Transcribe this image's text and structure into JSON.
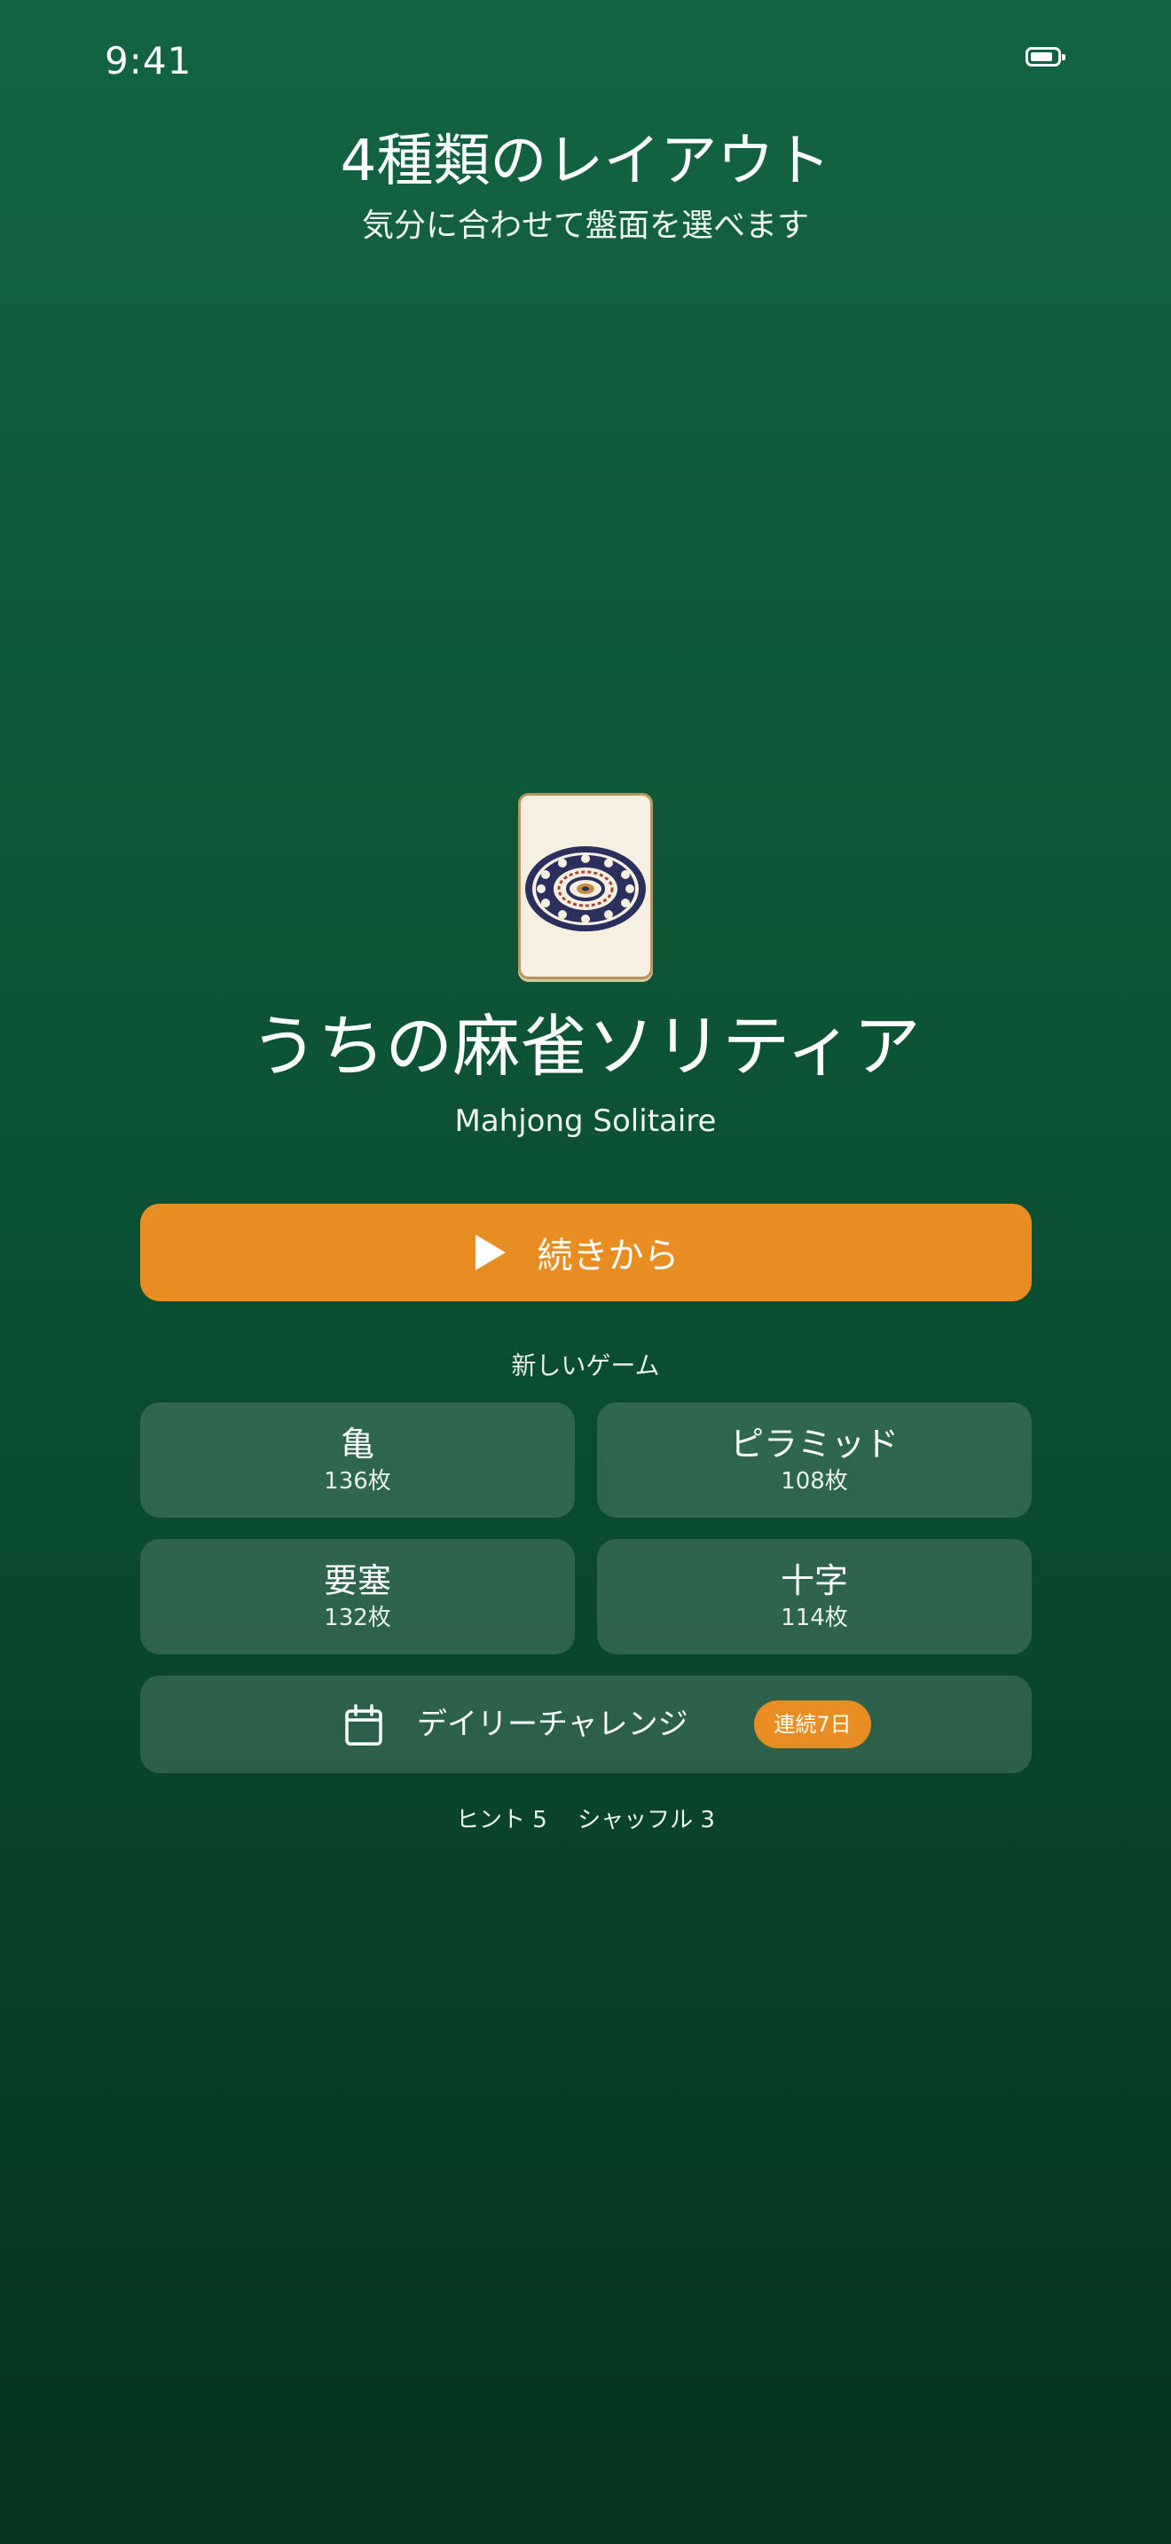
{
  "status_bar": {
    "time": "9:41",
    "battery_icon": "battery-icon"
  },
  "promo": {
    "title": "4種類のレイアウト",
    "subtitle": "気分に合わせて盤面を選べます"
  },
  "app": {
    "logo_icon": "mahjong-tile-icon",
    "title": "うちの麻雀ソリティア",
    "subtitle": "Mahjong Solitaire"
  },
  "continue_button": {
    "icon": "play-icon",
    "label": "続きから"
  },
  "new_game": {
    "section_label": "新しいゲーム",
    "layouts": [
      {
        "name": "亀",
        "count": "136枚"
      },
      {
        "name": "ピラミッド",
        "count": "108枚"
      },
      {
        "name": "要塞",
        "count": "132枚"
      },
      {
        "name": "十字",
        "count": "114枚"
      }
    ]
  },
  "daily_challenge": {
    "icon": "calendar-icon",
    "label": "デイリーチャレンジ",
    "streak_badge": "連続7日"
  },
  "footer": {
    "stats": "ヒント 5　 シャッフル 3"
  },
  "colors": {
    "accent": "#e88d22",
    "background_top": "#136444",
    "background_bottom": "#05331f"
  }
}
